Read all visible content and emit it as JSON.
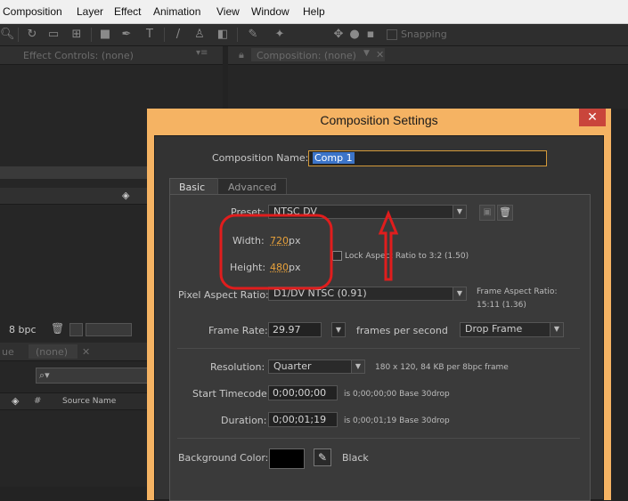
{
  "menu": [
    "Composition",
    "Layer",
    "Effect",
    "Animation",
    "View",
    "Window",
    "Help"
  ],
  "toolbar": {
    "snapping_label": "Snapping"
  },
  "panels": {
    "effect_controls_tab": "Effect Controls: (none)",
    "composition_tab": "Composition: (none)",
    "project_bpc": "8 bpc",
    "timeline_tab_partial": "ue",
    "timeline_tab": "(none)",
    "source_name_header": "Source Name",
    "number_header": "#"
  },
  "dialog": {
    "title": "Composition Settings",
    "close_glyph": "✕",
    "comp_name_label": "Composition Name:",
    "comp_name_value": "Comp 1",
    "tabs": [
      "Basic",
      "Advanced"
    ],
    "preset_label": "Preset:",
    "preset_value": "NTSC DV",
    "width_label": "Width:",
    "width_value": "720",
    "height_label": "Height:",
    "height_value": "480",
    "px_unit": "px",
    "lock_aspect_label": "Lock Aspect Ratio to 3:2 (1.50)",
    "lock_aspect_checked": false,
    "par_label": "Pixel Aspect Ratio:",
    "par_value": "D1/DV NTSC (0.91)",
    "frame_aspect_label": "Frame Aspect Ratio:",
    "frame_aspect_value": "15:11 (1.36)",
    "frame_rate_label": "Frame Rate:",
    "frame_rate_value": "29.97",
    "fps_label": "frames per second",
    "drop_frame_value": "Drop Frame",
    "resolution_label": "Resolution:",
    "resolution_value": "Quarter",
    "resolution_info": "180 x 120, 84 KB per 8bpc frame",
    "start_tc_label": "Start Timecode:",
    "start_tc_value": "0;00;00;00",
    "start_tc_info": "is 0;00;00;00  Base 30drop",
    "duration_label": "Duration:",
    "duration_value": "0;00;01;19",
    "duration_info": "is 0;00;01;19  Base 30drop",
    "bg_color_label": "Background Color:",
    "bg_color_name": "Black",
    "bg_color_hex": "#000000"
  },
  "annotations": {
    "highlight_color": "#e01d1d"
  }
}
